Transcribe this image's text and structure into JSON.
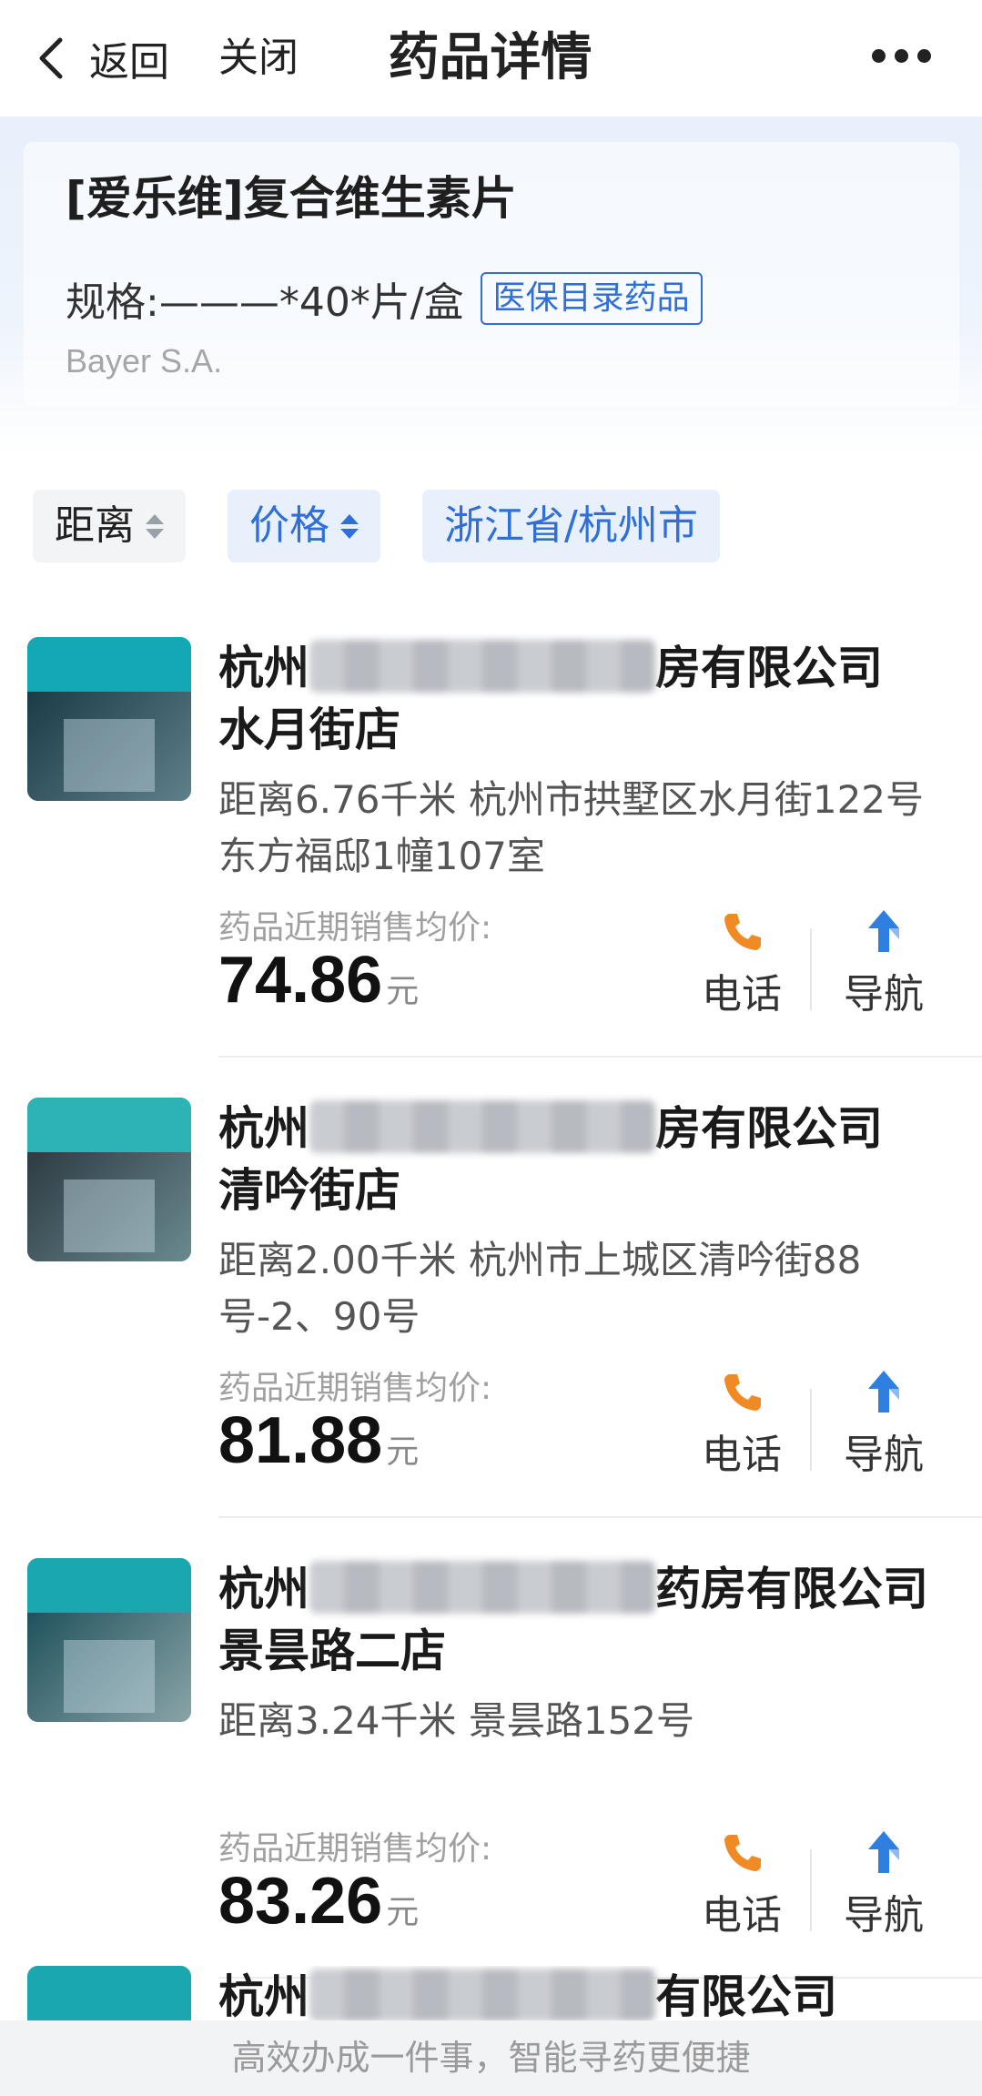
{
  "header": {
    "back_label": "返回",
    "close_label": "关闭",
    "title": "药品详情"
  },
  "drug": {
    "name": "[爱乐维]复合维生素片",
    "spec": "规格:———*40*片/盒",
    "badge": "医保目录药品",
    "manufacturer": "Bayer S.A."
  },
  "filters": {
    "distance": "距离",
    "price": "价格",
    "region": "浙江省/杭州市"
  },
  "stores": [
    {
      "name_prefix": "杭州",
      "name_suffix": "房有限公司",
      "branch": "水月街店",
      "address": "距离6.76千米 杭州市拱墅区水月街122号东方福邸1幢107室",
      "price_label": "药品近期销售均价:",
      "price": "74.86",
      "unit": "元",
      "call_label": "电话",
      "nav_label": "导航"
    },
    {
      "name_prefix": "杭州",
      "name_suffix": "房有限公司",
      "branch": "清吟街店",
      "address": "距离2.00千米 杭州市上城区清吟街88号-2、90号",
      "price_label": "药品近期销售均价:",
      "price": "81.88",
      "unit": "元",
      "call_label": "电话",
      "nav_label": "导航"
    },
    {
      "name_prefix": "杭州",
      "name_suffix": "药房有限公司",
      "branch": "景昙路二店",
      "address": "距离3.24千米 景昙路152号",
      "price_label": "药品近期销售均价:",
      "price": "83.26",
      "unit": "元",
      "call_label": "电话",
      "nav_label": "导航"
    },
    {
      "name_prefix": "杭州",
      "name_suffix": "有限公司"
    }
  ],
  "footer": {
    "slogan": "高效办成一件事，智能寻药更便捷"
  },
  "colors": {
    "accent": "#2f6fd6",
    "phone": "#f08a24",
    "nav": "#2f7fe0"
  }
}
